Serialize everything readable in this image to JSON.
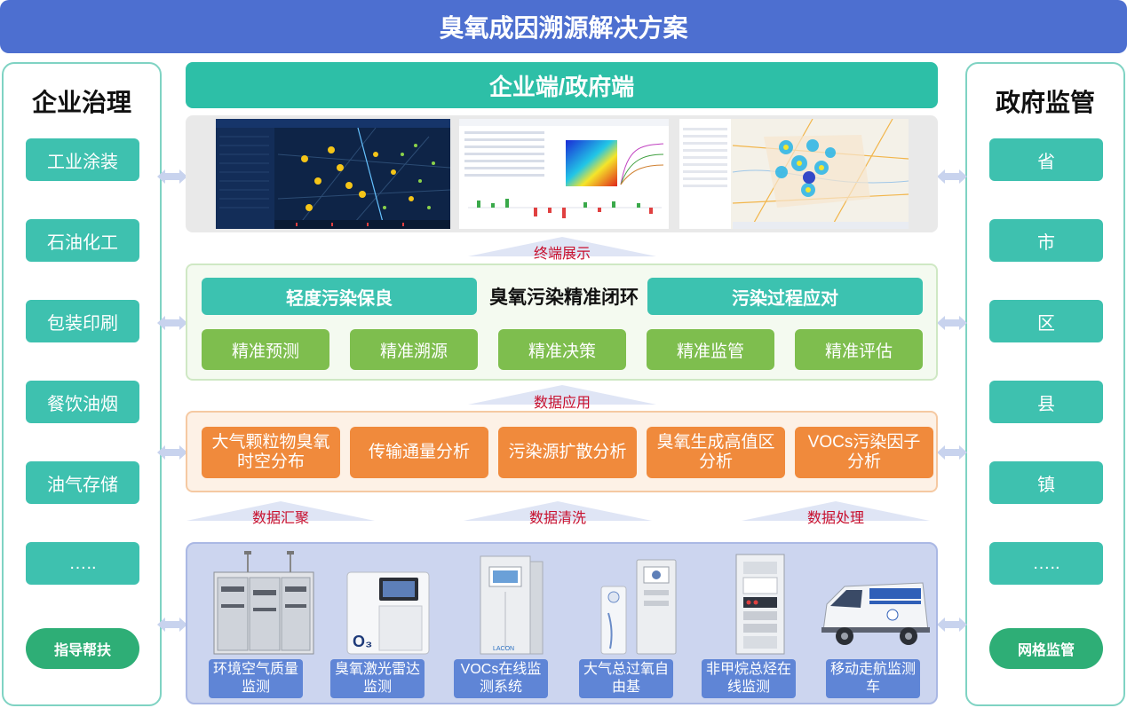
{
  "title": "臭氧成因溯源解决方案",
  "left_panel": {
    "title": "企业治理",
    "items": [
      "工业涂装",
      "石油化工",
      "包装印刷",
      "餐饮油烟",
      "油气存储",
      "….."
    ],
    "bottom": "指导帮扶"
  },
  "right_panel": {
    "title": "政府监管",
    "items": [
      "省",
      "市",
      "区",
      "县",
      "镇",
      "….."
    ],
    "bottom": "网格监管"
  },
  "terminal": {
    "header": "企业端/政府端",
    "label": "终端展示"
  },
  "closed_loop": {
    "left_bar": "轻度污染保良",
    "title": "臭氧污染精准闭环",
    "right_bar": "污染过程应对",
    "steps": [
      "精准预测",
      "精准溯源",
      "精准决策",
      "精准监管",
      "精准评估"
    ]
  },
  "data_application_label": "数据应用",
  "analysis": {
    "items": [
      "大气颗粒物臭氧时空分布",
      "传输通量分析",
      "污染源扩散分析",
      "臭氧生成高值区分析",
      "VOCs污染因子分析"
    ]
  },
  "data_flow": {
    "labels": [
      "数据汇聚",
      "数据清洗",
      "数据处理"
    ]
  },
  "devices": {
    "items": [
      "环境空气质量监测",
      "臭氧激光雷达监测",
      "VOCs在线监测系统",
      "大气总过氧自由基",
      "非甲烷总烃在线监测",
      "移动走航监测车"
    ],
    "lidar_mark": "O₃",
    "brand_text": "LACON"
  },
  "colors": {
    "title_bar": "#4d6fd0",
    "teal": "#3cc2b0",
    "green": "#7ebe4e",
    "orange": "#f08a3c",
    "device_label": "#5f85d6",
    "arrow_label": "#c8102e"
  }
}
